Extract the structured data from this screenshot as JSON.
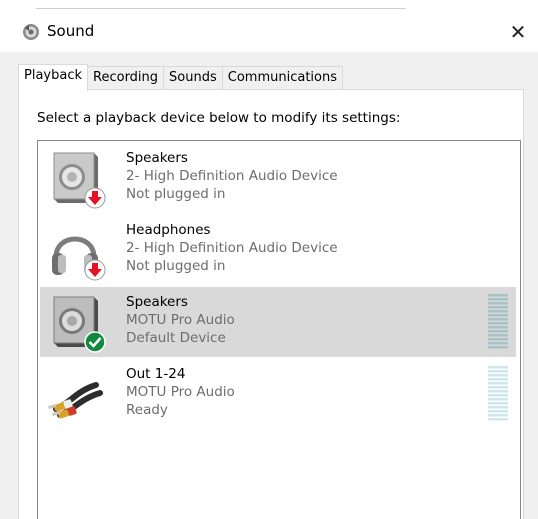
{
  "window": {
    "title": "Sound",
    "close_glyph": "✕"
  },
  "tabs": [
    {
      "label": "Playback",
      "active": true
    },
    {
      "label": "Recording",
      "active": false
    },
    {
      "label": "Sounds",
      "active": false
    },
    {
      "label": "Communications",
      "active": false
    }
  ],
  "instruction": "Select a playback device below to modify its settings:",
  "devices": [
    {
      "name": "Speakers",
      "description": "2- High Definition Audio Device",
      "status": "Not plugged in",
      "icon": "speaker-icon",
      "badge": "unplugged-badge-icon",
      "selected": false,
      "level": 0
    },
    {
      "name": "Headphones",
      "description": "2- High Definition Audio Device",
      "status": "Not plugged in",
      "icon": "headphones-icon",
      "badge": "unplugged-badge-icon",
      "selected": false,
      "level": 0
    },
    {
      "name": "Speakers",
      "description": "MOTU Pro Audio",
      "status": "Default Device",
      "icon": "speaker-icon",
      "badge": "default-check-badge-icon",
      "selected": true,
      "level": 0
    },
    {
      "name": "Out 1-24",
      "description": "MOTU Pro Audio",
      "status": "Ready",
      "icon": "rca-cable-icon",
      "badge": null,
      "selected": false,
      "level": 0
    }
  ],
  "colors": {
    "selected_row": "#d9d9d9",
    "unplugged_badge": "#e81123",
    "default_badge": "#10893e",
    "meter_selected": "#a7c3c7",
    "meter_idle": "#cfe6ea"
  }
}
